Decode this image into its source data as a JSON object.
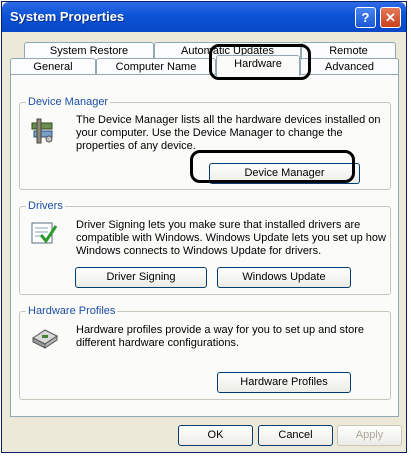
{
  "window": {
    "title": "System Properties",
    "help_label": "?",
    "close_label": "✕"
  },
  "tabs_back": [
    "System Restore",
    "Automatic Updates",
    "Remote"
  ],
  "tabs_front": [
    "General",
    "Computer Name",
    "Hardware",
    "Advanced"
  ],
  "active_tab": "Hardware",
  "device_manager": {
    "legend": "Device Manager",
    "description": "The Device Manager lists all the hardware devices installed on your computer. Use the Device Manager to change the properties of any device.",
    "button": "Device Manager",
    "icon": "device-manager-icon"
  },
  "drivers": {
    "legend": "Drivers",
    "description": "Driver Signing lets you make sure that installed drivers are compatible with Windows. Windows Update lets you set up how Windows connects to Windows Update for drivers.",
    "signing_button": "Driver Signing",
    "update_button": "Windows Update",
    "icon": "driver-checklist-icon"
  },
  "hardware_profiles": {
    "legend": "Hardware Profiles",
    "description": "Hardware profiles provide a way for you to set up and store different hardware configurations.",
    "button": "Hardware Profiles",
    "icon": "hardware-profile-icon"
  },
  "footer": {
    "ok": "OK",
    "cancel": "Cancel",
    "apply": "Apply"
  },
  "colors": {
    "titlebar": "#0a53d6",
    "dialog_bg": "#ece9d8",
    "group_label": "#1d4fa4"
  }
}
